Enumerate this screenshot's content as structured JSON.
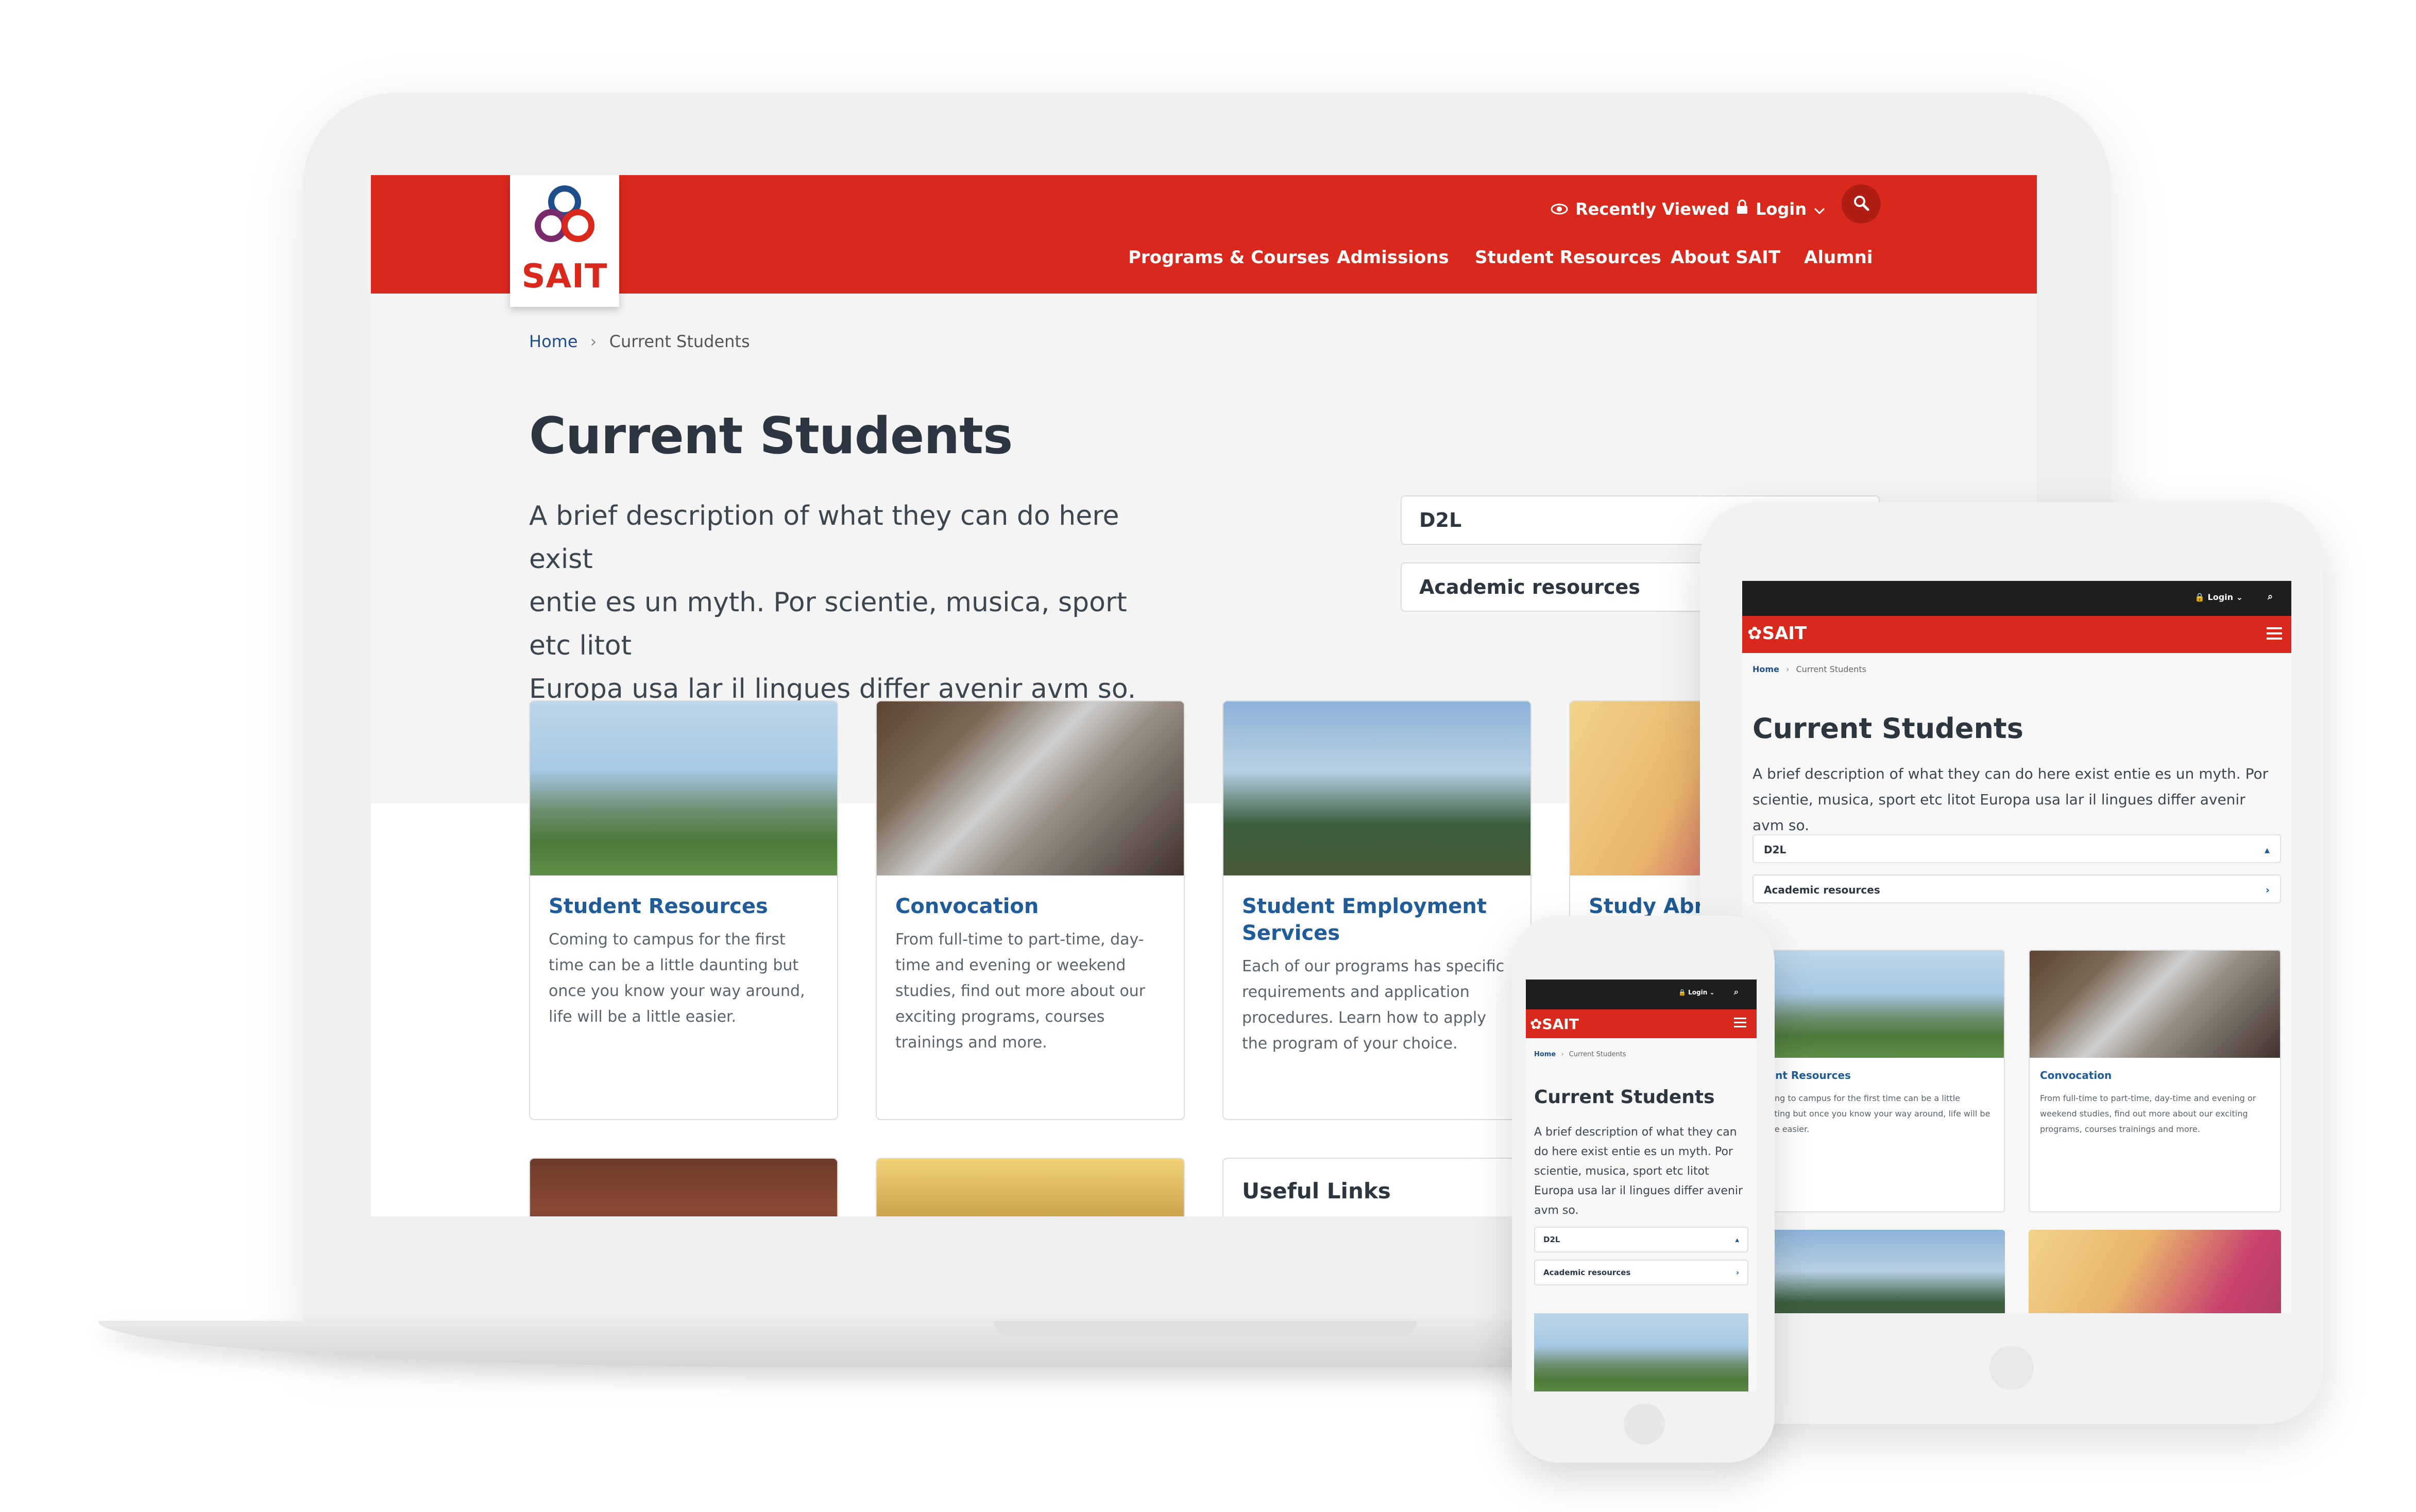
{
  "brand": {
    "logo_text": "SAIT",
    "primary_color": "#da291c",
    "link_color": "#1f5c99"
  },
  "utility": {
    "recently_viewed": "Recently Viewed",
    "login": "Login"
  },
  "nav": [
    "Programs & Courses",
    "Admissions",
    "Student Resources",
    "About SAIT",
    "Alumni"
  ],
  "breadcrumb": {
    "home": "Home",
    "current": "Current Students"
  },
  "page": {
    "title": "Current Students",
    "intro_lines": [
      "A brief description of what they can do here exist",
      "entie es un myth. Por scientie, musica, sport etc litot",
      "Europa usa lar il lingues differ avenir avm so."
    ],
    "intro_full": "A brief description of what they can do here exist entie es un myth. Por scientie, musica, sport etc litot Europa usa lar il lingues differ avenir avm so."
  },
  "quick_links": [
    "D2L",
    "Academic resources"
  ],
  "cards": [
    {
      "title": "Student Resources",
      "desc": "Coming to campus for the first time can be a little daunting but once you know your way around, life will be a little easier."
    },
    {
      "title": "Convocation",
      "desc": "From full-time to part-time, day-time and evening or weekend studies, find out more about our exciting programs, courses trainings and more."
    },
    {
      "title": "Student Employment Services",
      "desc": "Each of our programs has specific requirements and application procedures. Learn how to apply the program of your choice."
    },
    {
      "title": "Study Abroa"
    }
  ],
  "useful_links": "Useful Links",
  "tablet": {
    "card_1_title": "udent Resources"
  }
}
